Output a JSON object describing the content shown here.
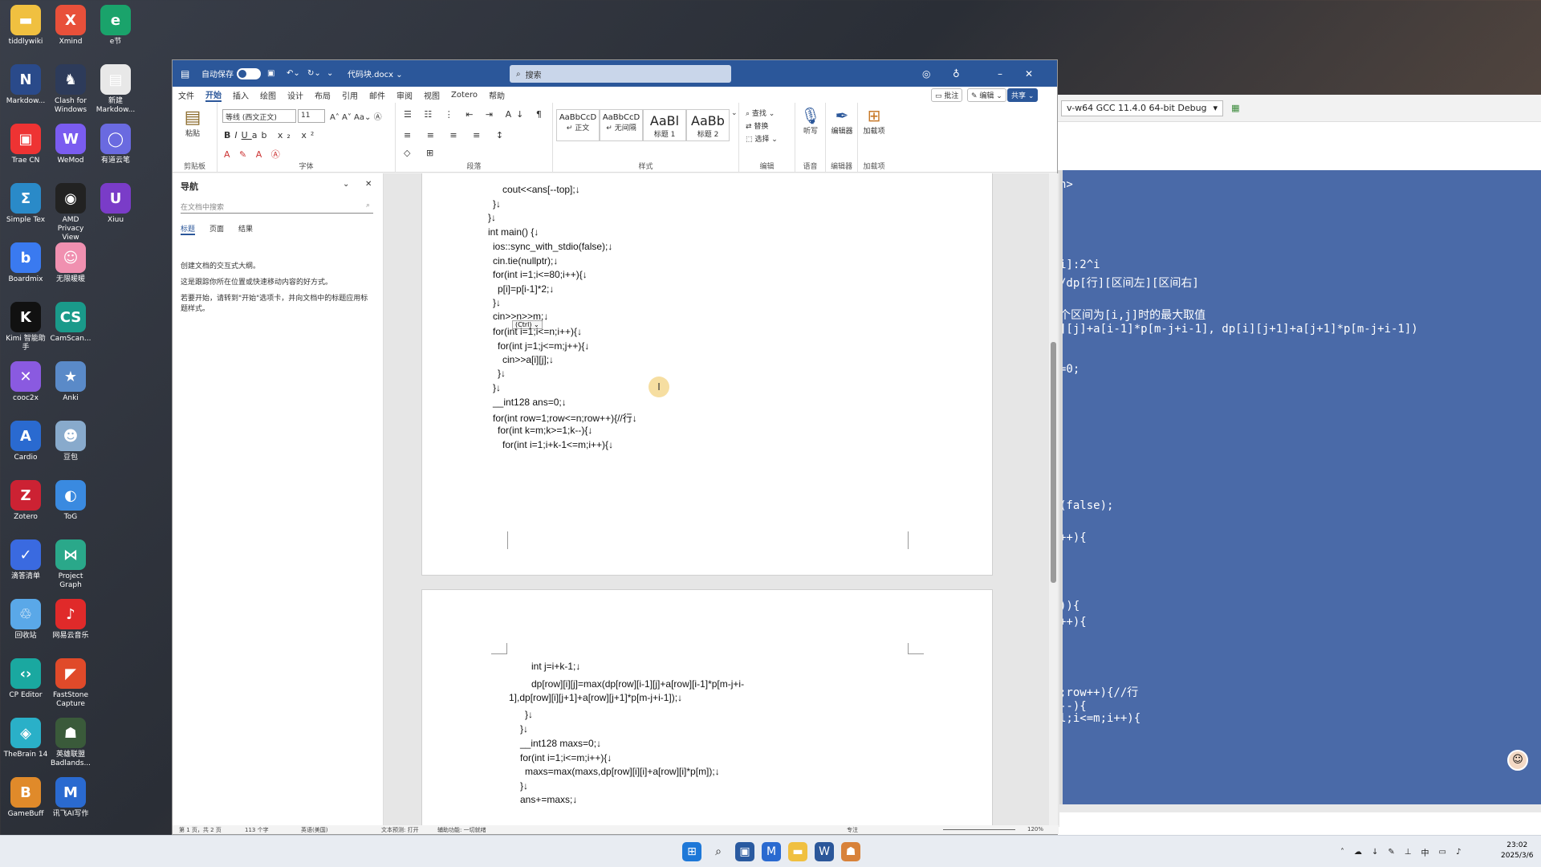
{
  "desktop": {
    "icons": [
      {
        "label": "tiddlywiki",
        "glyph": "▬",
        "color": "#f0c040"
      },
      {
        "label": "Xmind",
        "glyph": "X",
        "color": "#e8503a"
      },
      {
        "label": "e节",
        "glyph": "e",
        "color": "#1aa36b"
      },
      {
        "label": "Markdow...",
        "glyph": "N",
        "color": "#2a4a8a"
      },
      {
        "label": "Clash for Windows",
        "glyph": "♞",
        "color": "#2d3b5a"
      },
      {
        "label": "新建 Markdow...",
        "glyph": "▤",
        "color": "#e8e8e8"
      },
      {
        "label": "Trae CN",
        "glyph": "▣",
        "color": "#e33"
      },
      {
        "label": "WeMod",
        "glyph": "W",
        "color": "#7a5cf0"
      },
      {
        "label": "有道云笔",
        "glyph": "◯",
        "color": "#6a6ae0"
      },
      {
        "label": "Simple Tex",
        "glyph": "Σ",
        "color": "#2a8ac8"
      },
      {
        "label": "AMD Privacy View",
        "glyph": "◉",
        "color": "#222"
      },
      {
        "label": "Xiuu",
        "glyph": "U",
        "color": "#7a3cc8"
      },
      {
        "label": "Boardmix",
        "glyph": "b",
        "color": "#3a7af0"
      },
      {
        "label": "无限暖暖",
        "glyph": "☺",
        "color": "#f090b0"
      },
      {
        "label": "Kimi 智能助手",
        "glyph": "K",
        "color": "#111"
      },
      {
        "label": "CamScan...",
        "glyph": "CS",
        "color": "#1a9a8a"
      },
      {
        "label": "cooc2x",
        "glyph": "✕",
        "color": "#8a5ae0"
      },
      {
        "label": "Anki",
        "glyph": "★",
        "color": "#5a8ac8"
      },
      {
        "label": "Cardio",
        "glyph": "A",
        "color": "#2a6ad0"
      },
      {
        "label": "豆包",
        "glyph": "☻",
        "color": "#88aacc"
      },
      {
        "label": "Zotero",
        "glyph": "Z",
        "color": "#cc2233"
      },
      {
        "label": "ToG",
        "glyph": "◐",
        "color": "#3a8ae0"
      },
      {
        "label": "滴答清单",
        "glyph": "✓",
        "color": "#3a6ae0"
      },
      {
        "label": "Project Graph",
        "glyph": "⋈",
        "color": "#2aa88a"
      },
      {
        "label": "回收站",
        "glyph": "♲",
        "color": "#5aa8e8"
      },
      {
        "label": "网易云音乐",
        "glyph": "♪",
        "color": "#e02a2a"
      },
      {
        "label": "CP Editor",
        "glyph": "‹›",
        "color": "#1aa8a0"
      },
      {
        "label": "FastStone Capture",
        "glyph": "◤",
        "color": "#e04a2a"
      },
      {
        "label": "TheBrain 14",
        "glyph": "◈",
        "color": "#2ab0c8"
      },
      {
        "label": "英雄联盟 Badlands...",
        "glyph": "☗",
        "color": "#3a5a3a"
      },
      {
        "label": "GameBuff",
        "glyph": "B",
        "color": "#e08a2a"
      },
      {
        "label": "讯飞AI写作",
        "glyph": "M",
        "color": "#2a6ad0"
      }
    ]
  },
  "ide": {
    "config": "v-w64 GCC 11.4.0 64-bit Debug",
    "code_lines": [
      "h>",
      "i]:2^i",
      "/dp[行][区间左][区间右]",
      "个区间为[i,j]时的最大取值",
      "][j]+a[i-1]*p[m-j+i-1], dp[i][j+1]+a[j+1]*p[m-j+i-1])",
      "=0;",
      "(false);",
      "++){",
      ")){",
      "++){",
      ";row++){//行",
      "--){",
      "l;i<=m;i++){"
    ]
  },
  "word": {
    "autosave": "自动保存",
    "filename": "代码块.docx ⌄",
    "search_placeholder": "搜索",
    "menus": [
      "文件",
      "开始",
      "插入",
      "绘图",
      "设计",
      "布局",
      "引用",
      "邮件",
      "审阅",
      "视图",
      "Zotero",
      "帮助"
    ],
    "active_menu": "开始",
    "comment_btn": "批注",
    "edit_btn": "编辑 ⌄",
    "share_btn": "共享 ⌄",
    "ribbon": {
      "paste": "粘贴",
      "clipboard": "剪贴板",
      "font_name": "等线 (西文正文)",
      "font_size": "11",
      "font": "字体",
      "paragraph": "段落",
      "styles": [
        {
          "preview": "AaBbCcD",
          "name": "↵ 正文"
        },
        {
          "preview": "AaBbCcD",
          "name": "↵ 无间隔"
        },
        {
          "preview": "AaBl",
          "name": "标题 1"
        },
        {
          "preview": "AaBb",
          "name": "标题 2"
        }
      ],
      "style_group": "样式",
      "find": "查找 ⌄",
      "replace": "替换",
      "select": "选择 ⌄",
      "editing": "编辑",
      "dictate": "听写",
      "voice": "语音",
      "editor": "编辑器",
      "editor_grp": "编辑器",
      "addins": "加载项",
      "addins_grp": "加载项"
    },
    "nav": {
      "title": "导航",
      "search_placeholder": "在文档中搜索",
      "tabs": [
        "标题",
        "页面",
        "结果"
      ],
      "hint1": "创建文档的交互式大纲。",
      "hint2": "这是跟踪你所在位置或快速移动内容的好方式。",
      "hint3": "若要开始，请转到\"开始\"选项卡，并向文档中的标题应用标题样式。"
    },
    "page1_lines": [
      "cout<<ans[--top];↓",
      "}↓",
      "}↓",
      "int main() {↓",
      "ios::sync_with_stdio(false);↓",
      "cin.tie(nullptr);↓",
      "for(int i=1;i<=80;i++){↓",
      "p[i]=p[i-1]*2;↓",
      "}↓",
      "cin>>n>>m;↓",
      "for(int i=1;i<=n;i++){↓",
      "for(int j=1;j<=m;j++){↓",
      "cin>>a[i][j];↓",
      "}↓",
      "}↓",
      "__int128 ans=0;↓",
      "for(int row=1;row<=n;row++){//行↓",
      "for(int k=m;k>=1;k--){↓",
      "for(int i=1;i+k-1<=m;i++){↓"
    ],
    "paste_tag": "(Ctrl) ⌄",
    "page2_lines": [
      "int j=i+k-1;↓",
      "dp[row][i][j]=max(dp[row][i-1][j]+a[row][i-1]*p[m-j+i-",
      "1],dp[row][i][j+1]+a[row][j+1]*p[m-j+i-1]);↓",
      "}↓",
      "}↓",
      "__int128 maxs=0;↓",
      "for(int i=1;i<=m;i++){↓",
      "maxs=max(maxs,dp[row][i][i]+a[row][i]*p[m]);↓",
      "}↓",
      "ans+=maxs;↓"
    ],
    "status": {
      "page": "第 1 页，共 2 页",
      "words": "113 个字",
      "lang": "英语(美国)",
      "predict": "文本预测: 打开",
      "access": "辅助功能: 一切就绪",
      "focus": "专注",
      "zoom": "120%"
    }
  },
  "taskbar": {
    "time": "23:02",
    "date": "2025/3/6"
  }
}
